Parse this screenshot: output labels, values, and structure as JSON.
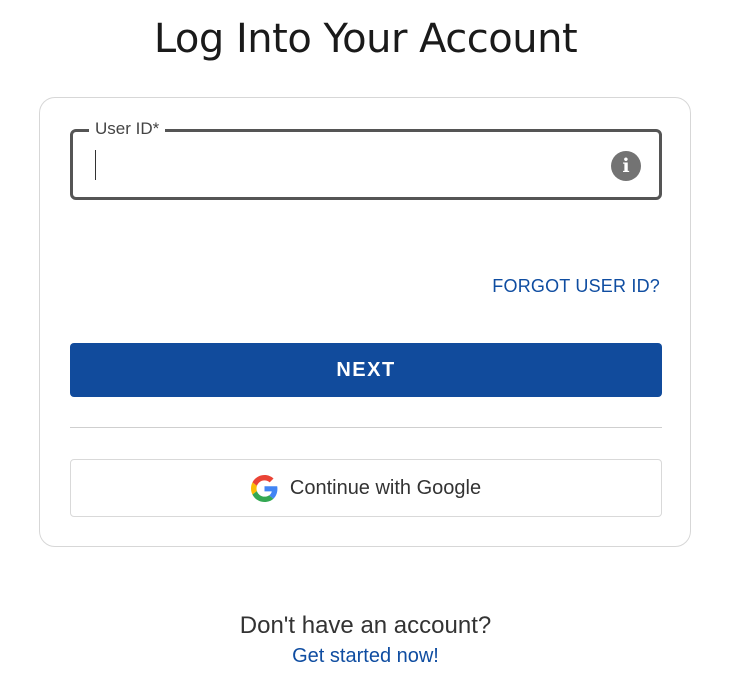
{
  "page": {
    "title": "Log Into Your Account"
  },
  "login_form": {
    "user_id_label": "User ID*",
    "user_id_value": "",
    "info_icon": "info-icon",
    "forgot_link": "FORGOT USER ID?",
    "next_label": "NEXT",
    "google_label": "Continue with Google",
    "google_icon": "google-logo-icon"
  },
  "footer": {
    "prompt": "Don't have an account?",
    "signup_link": "Get started now!"
  },
  "colors": {
    "primary": "#114b9c",
    "link": "#0f4da1",
    "field_border": "#555555",
    "info_icon_bg": "#737373"
  }
}
